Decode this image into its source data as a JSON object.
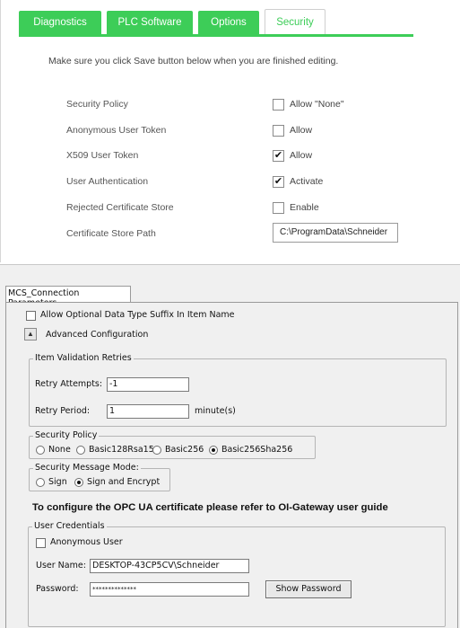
{
  "web_config": {
    "tabs": [
      {
        "label": "Diagnostics",
        "active": false
      },
      {
        "label": "PLC Software",
        "active": false
      },
      {
        "label": "Options",
        "active": false
      },
      {
        "label": "Security",
        "active": true
      }
    ],
    "notice": "Make sure you click Save button below when you are finished editing.",
    "rows": [
      {
        "label": "Security Policy",
        "checkbox_label": "Allow \"None\"",
        "checked": false
      },
      {
        "label": "Anonymous User Token",
        "checkbox_label": "Allow",
        "checked": false
      },
      {
        "label": "X509 User Token",
        "checkbox_label": "Allow",
        "checked": true
      },
      {
        "label": "User Authentication",
        "checkbox_label": "Activate",
        "checked": true
      },
      {
        "label": "Rejected Certificate Store",
        "checkbox_label": "Enable",
        "checked": false
      }
    ],
    "cert_store_path": {
      "label": "Certificate Store Path",
      "value": "C:\\ProgramData\\Schneider"
    },
    "accent_color": "#3dcd58"
  },
  "dialog": {
    "tab_label": "MCS_Connection Parameters",
    "allow_suffix": {
      "label": "Allow Optional Data Type Suffix In Item Name",
      "checked": false
    },
    "advanced": {
      "label": "Advanced Configuration",
      "icon": "chevron-up-icon"
    },
    "item_validation": {
      "title": "Item Validation Retries",
      "retry_attempts": {
        "label": "Retry Attempts:",
        "value": "-1"
      },
      "retry_period": {
        "label": "Retry Period:",
        "value": "1",
        "unit": "minute(s)"
      }
    },
    "security_policy": {
      "title": "Security Policy",
      "options": [
        {
          "label": "None",
          "selected": false
        },
        {
          "label": "Basic128Rsa15",
          "selected": false
        },
        {
          "label": "Basic256",
          "selected": false
        },
        {
          "label": "Basic256Sha256",
          "selected": true
        }
      ]
    },
    "security_mode": {
      "title": "Security Message Mode:",
      "options": [
        {
          "label": "Sign",
          "selected": false
        },
        {
          "label": "Sign and Encrypt",
          "selected": true
        }
      ]
    },
    "note": "To configure the OPC UA certificate please refer to OI-Gateway user guide",
    "user_credentials": {
      "title": "User Credentials",
      "anonymous": {
        "label": "Anonymous User",
        "checked": false
      },
      "user_name": {
        "label": "User Name:",
        "value": "DESKTOP-43CP5CV\\Schneider"
      },
      "password": {
        "label": "Password:",
        "value": "**************"
      },
      "show_password_label": "Show Password"
    }
  }
}
